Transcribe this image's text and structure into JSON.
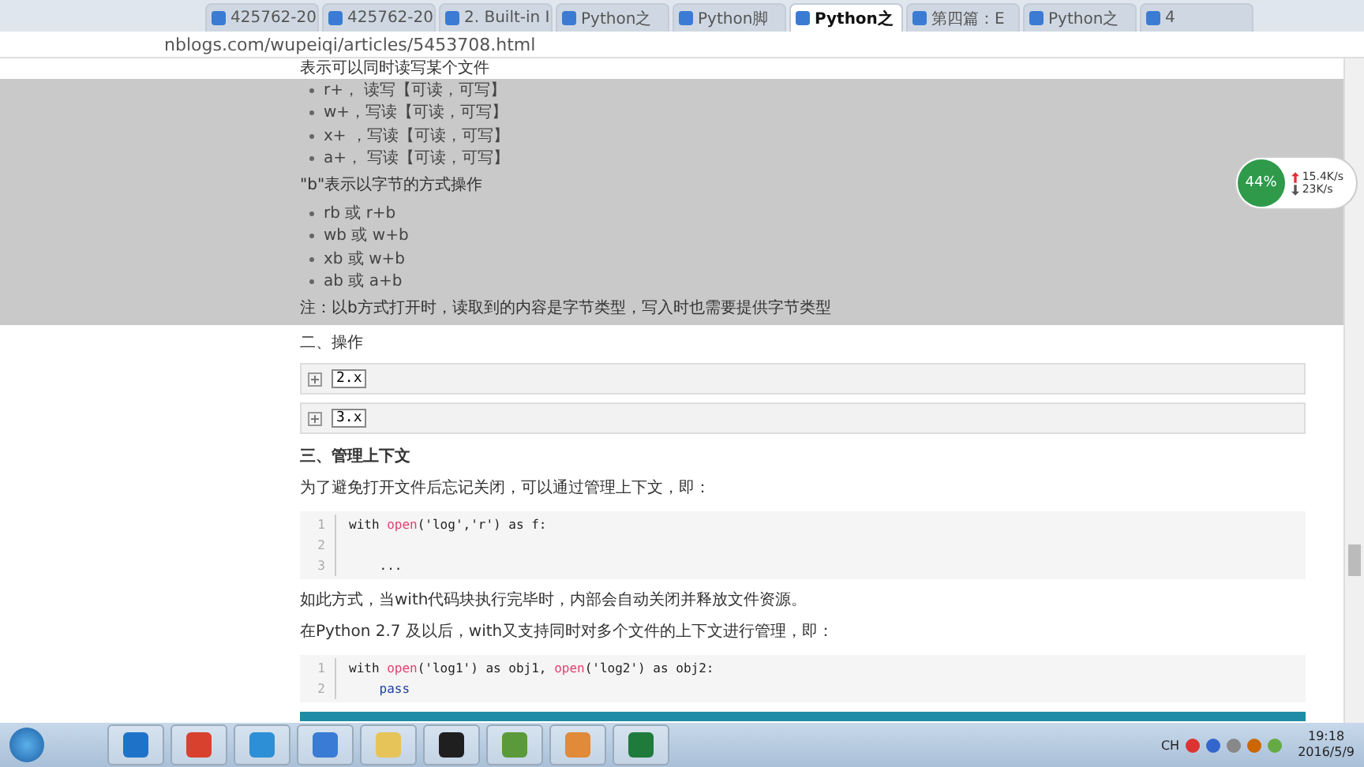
{
  "browser": {
    "tabs": [
      {
        "label": "425762-20",
        "selected": false
      },
      {
        "label": "425762-20",
        "selected": false
      },
      {
        "label": "2. Built-in I",
        "selected": false
      },
      {
        "label": "Python之",
        "selected": false
      },
      {
        "label": "Python脚",
        "selected": false
      },
      {
        "label": "Python之",
        "selected": true
      },
      {
        "label": "第四篇：E",
        "selected": false
      },
      {
        "label": "Python之",
        "selected": false
      },
      {
        "label": "4",
        "selected": false
      }
    ],
    "url": "nblogs.com/wupeiqi/articles/5453708.html"
  },
  "article": {
    "top_line": "表示可以同时读写某个文件",
    "selected_block": {
      "selected": true,
      "modes": [
        "r+， 读写【可读，可写】",
        "w+，写读【可读，可写】",
        "x+ ，写读【可读，可写】",
        "a+， 写读【可读，可写】"
      ],
      "b_heading": "\"b\"表示以字节的方式操作",
      "b_modes": [
        "rb  或 r+b",
        "wb 或 w+b",
        "xb 或 w+b",
        "ab 或 a+b"
      ],
      "note": "注：以b方式打开时，读取到的内容是字节类型，写入时也需要提供字节类型"
    },
    "section2": "二、操作",
    "folds": [
      {
        "label": "2.x",
        "expanded": false
      },
      {
        "label": "3.x",
        "expanded": false
      }
    ],
    "section3": "三、管理上下文",
    "para1": "为了避免打开文件后忘记关闭，可以通过管理上下文，即：",
    "code1": [
      {
        "num": "1",
        "parts": [
          {
            "t": "with ",
            "kind": "plain"
          },
          {
            "t": "open",
            "kind": "builtin"
          },
          {
            "t": "('log','r') as f:",
            "kind": "plain"
          }
        ]
      },
      {
        "num": "2"
      },
      {
        "num": "3",
        "parts": [
          {
            "t": "    ...",
            "kind": "plain"
          }
        ]
      }
    ],
    "para2": "如此方式，当with代码块执行完毕时，内部会自动关闭并释放文件资源。",
    "para3": "在Python 2.7 及以后，with又支持同时对多个文件的上下文进行管理，即：",
    "code2": [
      {
        "num": "1",
        "parts": [
          {
            "t": "with ",
            "kind": "plain"
          },
          {
            "t": "open",
            "kind": "builtin"
          },
          {
            "t": "('log1') as obj1, ",
            "kind": "plain"
          },
          {
            "t": "open",
            "kind": "builtin"
          },
          {
            "t": "('log2') as obj2:",
            "kind": "plain"
          }
        ]
      },
      {
        "num": "2",
        "parts": [
          {
            "t": "    pass",
            "kind": "keyword"
          }
        ]
      }
    ]
  },
  "net_widget": {
    "percent": "44%",
    "upload": "15.4K/s",
    "download": "23K/s"
  },
  "taskbar": {
    "apps": [
      {
        "kind": "ie"
      },
      {
        "kind": "chrome"
      },
      {
        "kind": "cloud"
      },
      {
        "kind": "player"
      },
      {
        "kind": "folder"
      },
      {
        "kind": "pycharm"
      },
      {
        "kind": "notepad"
      },
      {
        "kind": "people"
      },
      {
        "kind": "excel"
      }
    ],
    "lang": "CH",
    "time": "19:18",
    "date": "2016/5/9"
  }
}
